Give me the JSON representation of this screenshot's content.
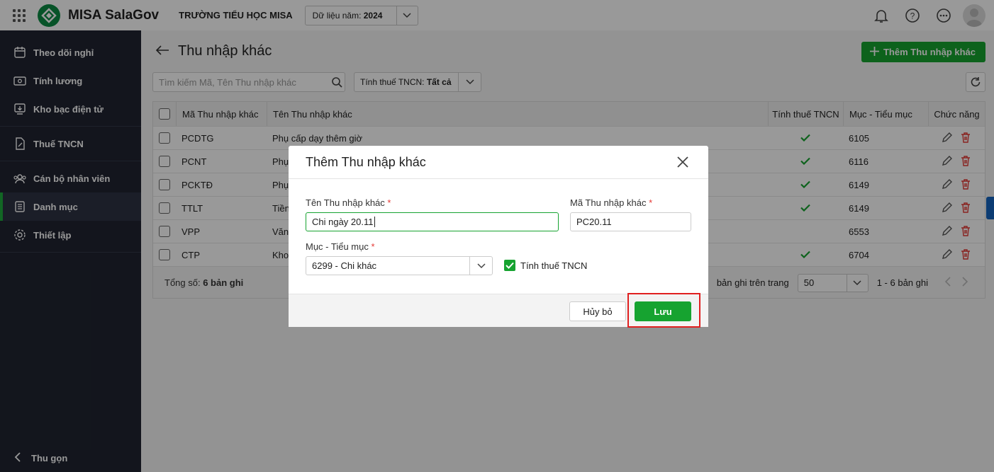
{
  "topbar": {
    "app_name": "MISA SalaGov",
    "school": "TRƯỜNG TIỂU HỌC MISA",
    "year_label": "Dữ liệu năm:",
    "year_value": "2024"
  },
  "sidebar": {
    "items": [
      {
        "label": "Theo dõi nghỉ",
        "icon": "calendar-icon"
      },
      {
        "label": "Tính lương",
        "icon": "payroll-icon"
      },
      {
        "label": "Kho bạc điện tử",
        "icon": "treasury-icon"
      },
      {
        "label": "Thuế TNCN",
        "icon": "tax-document-icon"
      },
      {
        "label": "Cán bộ nhân viên",
        "icon": "staff-icon"
      },
      {
        "label": "Danh mục",
        "icon": "catalog-icon"
      },
      {
        "label": "Thiết lập",
        "icon": "gear-icon"
      }
    ],
    "active": "Danh mục",
    "collapse_label": "Thu gọn"
  },
  "page": {
    "title": "Thu nhập khác",
    "add_button": "Thêm Thu nhập khác",
    "search_placeholder": "Tìm kiếm Mã, Tên Thu nhập khác",
    "tax_filter_label": "Tính thuế TNCN:",
    "tax_filter_value": "Tất cả"
  },
  "table": {
    "headers": [
      "Mã Thu nhập khác",
      "Tên Thu nhập khác",
      "Tính thuế TNCN",
      "Mục - Tiểu mục",
      "Chức năng"
    ],
    "rows": [
      {
        "ma": "PCDTG",
        "ten": "Phụ cấp dạy thêm giờ",
        "tax": true,
        "muc": "6105"
      },
      {
        "ma": "PCNT",
        "ten": "Phụ",
        "tax": true,
        "muc": "6116"
      },
      {
        "ma": "PCKTĐ",
        "ten": "Phụ",
        "tax": true,
        "muc": "6149"
      },
      {
        "ma": "TTLT",
        "ten": "Tiền",
        "tax": true,
        "muc": "6149"
      },
      {
        "ma": "VPP",
        "ten": "Văn",
        "tax": false,
        "muc": "6553"
      },
      {
        "ma": "CTP",
        "ten": "Kho",
        "tax": true,
        "muc": "6704"
      }
    ],
    "total_label": "Tổng số:",
    "total_value": "6 bản ghi",
    "per_page_label": "bản ghi trên trang",
    "per_page_value": "50",
    "range": "1 - 6 bản ghi"
  },
  "modal": {
    "title": "Thêm Thu nhập khác",
    "name_label": "Tên Thu nhập khác",
    "name_value": "Chi ngày 20.11",
    "code_label": "Mã Thu nhập khác",
    "code_value": "PC20.11",
    "muc_label": "Mục - Tiểu mục",
    "muc_value": "6299 - Chi khác",
    "tax_checkbox_label": "Tính thuế TNCN",
    "tax_checked": true,
    "cancel_button": "Hủy bỏ",
    "save_button": "Lưu",
    "required_mark": "*"
  },
  "colors": {
    "accent": "#16a330",
    "sidebar_bg": "#202431",
    "highlight": "#e02020"
  }
}
